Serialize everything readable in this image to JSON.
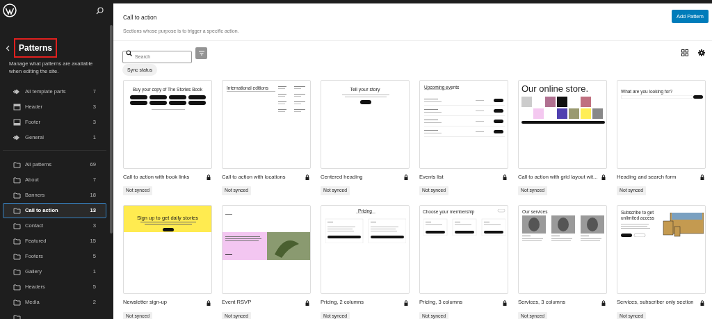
{
  "sidebar": {
    "title": "Patterns",
    "title_highlighted": true,
    "description": "Manage what patterns are available when editing the site.",
    "template_parts": [
      {
        "kind": "all-parts",
        "label": "All template parts",
        "count": "7",
        "selected": false
      },
      {
        "kind": "header",
        "label": "Header",
        "count": "3",
        "selected": false
      },
      {
        "kind": "footer",
        "label": "Footer",
        "count": "3",
        "selected": false
      },
      {
        "kind": "all-parts",
        "label": "General",
        "count": "1",
        "selected": false
      }
    ],
    "categories": [
      {
        "kind": "folder",
        "label": "All patterns",
        "count": "69",
        "selected": false
      },
      {
        "kind": "folder",
        "label": "About",
        "count": "7",
        "selected": false
      },
      {
        "kind": "folder",
        "label": "Banners",
        "count": "18",
        "selected": false
      },
      {
        "kind": "folder",
        "label": "Call to action",
        "count": "13",
        "selected": true
      },
      {
        "kind": "folder",
        "label": "Contact",
        "count": "3",
        "selected": false
      },
      {
        "kind": "folder",
        "label": "Featured",
        "count": "15",
        "selected": false
      },
      {
        "kind": "folder",
        "label": "Footers",
        "count": "5",
        "selected": false
      },
      {
        "kind": "folder",
        "label": "Gallery",
        "count": "1",
        "selected": false
      },
      {
        "kind": "folder",
        "label": "Headers",
        "count": "5",
        "selected": false
      },
      {
        "kind": "folder",
        "label": "Media",
        "count": "2",
        "selected": false
      },
      {
        "kind": "folder",
        "selected": false
      }
    ]
  },
  "header": {
    "title": "Call to action",
    "description": "Sections whose purpose is to trigger a specific action.",
    "add_button": "Add Pattern"
  },
  "toolbar": {
    "search_placeholder": "Search",
    "filter_chip": "Sync status"
  },
  "patterns": [
    {
      "title": "Call to action with book links",
      "locked": true,
      "status": "Not synced",
      "preview": {
        "kind": "buttons",
        "heading": "Buy your copy of The Stories Book"
      }
    },
    {
      "title": "Call to action with locations",
      "locked": true,
      "status": "Not synced",
      "preview": {
        "kind": "locations",
        "heading": "International editions"
      }
    },
    {
      "title": "Centered heading",
      "locked": true,
      "status": "Not synced",
      "preview": {
        "kind": "centered",
        "heading": "Tell your story"
      }
    },
    {
      "title": "Events list",
      "locked": true,
      "status": "Not synced",
      "preview": {
        "kind": "events",
        "heading": "Upcoming events"
      }
    },
    {
      "title": "Call to action with grid layout wit...",
      "locked": true,
      "status": "Not synced",
      "preview": {
        "kind": "store",
        "heading": "Our online store."
      }
    },
    {
      "title": "Heading and search form",
      "locked": true,
      "status": "Not synced",
      "preview": {
        "kind": "search",
        "heading": "What are you looking for?"
      }
    },
    {
      "title": "Newsletter sign-up",
      "locked": true,
      "status": "Not synced",
      "preview": {
        "kind": "banner",
        "heading": "Sign up to get daily stories"
      }
    },
    {
      "title": "Event RSVP",
      "locked": true,
      "status": "Not synced",
      "preview": {
        "kind": "rsvp"
      }
    },
    {
      "title": "Pricing, 2 columns",
      "locked": true,
      "status": "Not synced",
      "preview": {
        "kind": "pricing2",
        "heading": "Pricing"
      }
    },
    {
      "title": "Pricing, 3 columns",
      "locked": true,
      "status": "Not synced",
      "preview": {
        "kind": "pricing3",
        "heading": "Choose your membership"
      }
    },
    {
      "title": "Services, 3 columns",
      "locked": true,
      "status": "Not synced",
      "preview": {
        "kind": "services",
        "heading": "Our services"
      }
    },
    {
      "title": "Services, subscriber only section",
      "locked": true,
      "status": "Not synced",
      "preview": {
        "kind": "subscribe",
        "heading": "Subscribe to get unlimited access"
      }
    }
  ]
}
